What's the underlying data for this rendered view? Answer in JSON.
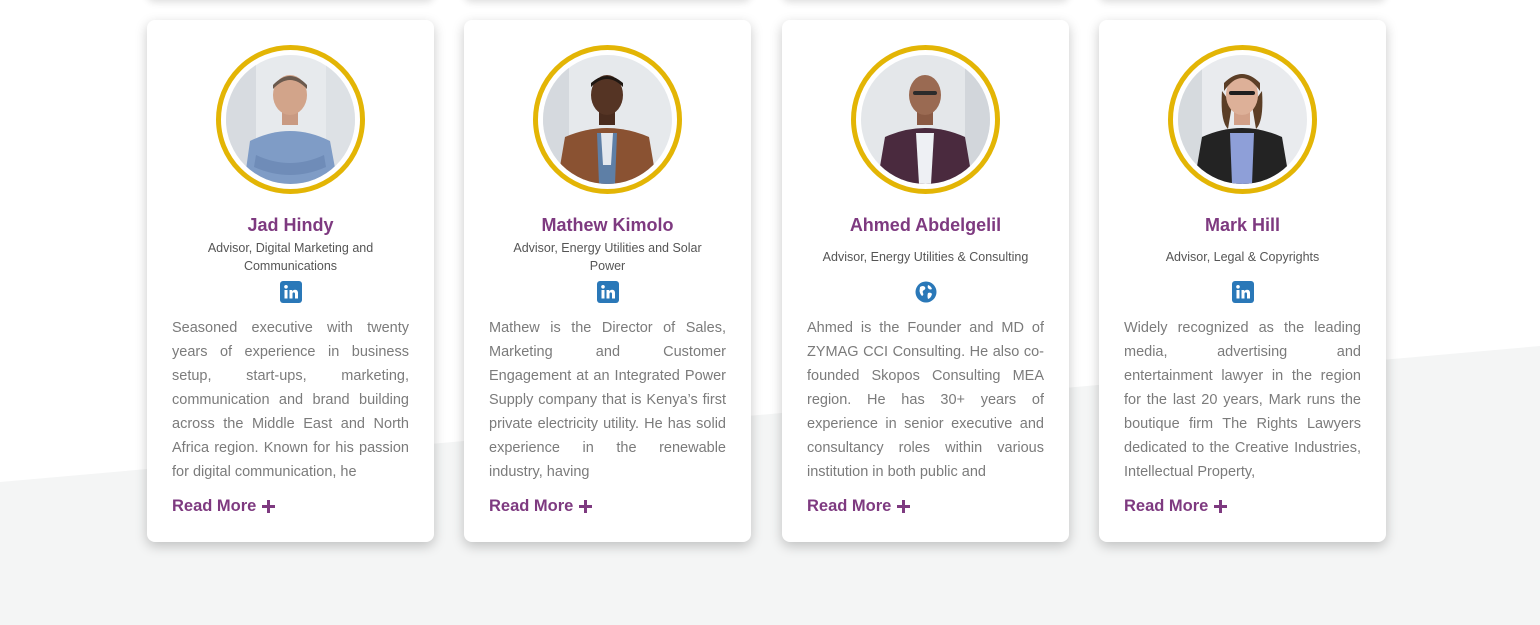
{
  "colors": {
    "name": "#7e3a80",
    "ring": "#e3b505",
    "icon": "#2a78b8",
    "bio_text": "#7b7b7b",
    "role_text": "#555555",
    "background_band": "#f4f5f5"
  },
  "team": [
    {
      "name": "Jad Hindy",
      "role": "Advisor, Digital Marketing and Communications",
      "social_icon": "linkedin-icon",
      "bio": "Seasoned executive with twenty years of experience in business setup, start-ups, marketing, communication and brand building across the Middle East and North Africa region. Known for his passion for digital communication, he",
      "read_more": "Read More"
    },
    {
      "name": "Mathew Kimolo",
      "role": "Advisor, Energy Utilities and Solar Power",
      "social_icon": "linkedin-icon",
      "bio": "Mathew is the Director of Sales, Marketing and Customer Engagement at an Integrated Power Supply company that is Kenya’s first private electricity utility. He has solid experience in the renewable industry, having",
      "read_more": "Read More"
    },
    {
      "name": "Ahmed Abdelgelil",
      "role": "Advisor, Energy Utilities & Consulting",
      "social_icon": "globe-icon",
      "bio": "Ahmed is the Founder and MD of ZYMAG CCI Consulting. He also co-founded Skopos Consulting MEA region. He has 30+ years of experience in senior executive and consultancy roles within various institution in both public and",
      "read_more": "Read More"
    },
    {
      "name": "Mark Hill",
      "role": "Advisor, Legal & Copyrights",
      "social_icon": "linkedin-icon",
      "bio": "Widely recognized as the leading media, advertising and entertainment lawyer in the region for the last 20 years, Mark runs the boutique firm The Rights Lawyers dedicated to the Creative Industries, Intellectual Property,",
      "read_more": "Read More"
    }
  ]
}
